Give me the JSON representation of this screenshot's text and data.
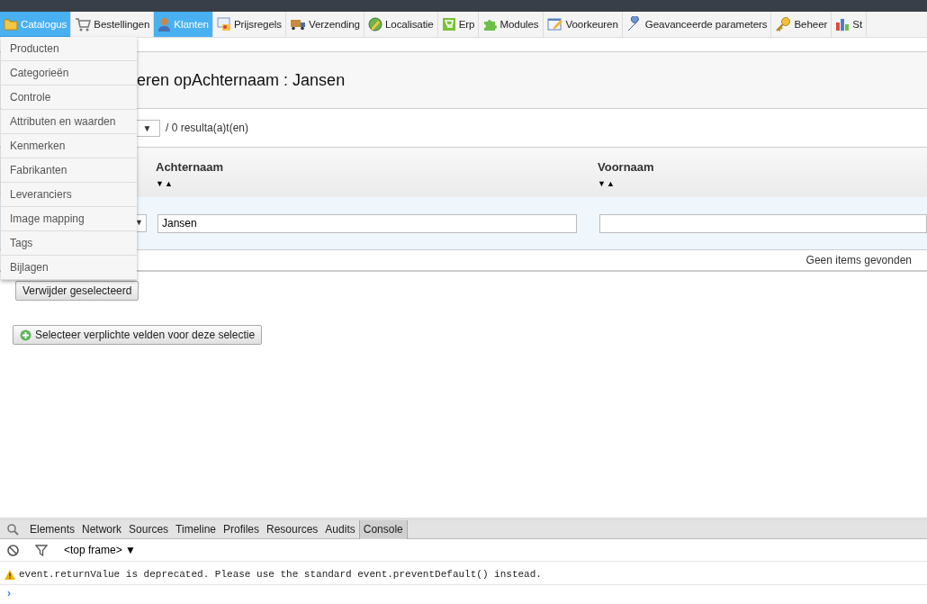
{
  "nav": {
    "tabs": [
      {
        "label": "Catalogus",
        "selected": true,
        "expanded": true
      },
      {
        "label": "Bestellingen",
        "selected": false,
        "expanded": false
      },
      {
        "label": "Klanten",
        "selected": true,
        "expanded": false
      },
      {
        "label": "Prijsregels",
        "selected": false,
        "expanded": false
      },
      {
        "label": "Verzending",
        "selected": false,
        "expanded": false
      },
      {
        "label": "Localisatie",
        "selected": false,
        "expanded": false
      },
      {
        "label": "Erp",
        "selected": false,
        "expanded": false
      },
      {
        "label": "Modules",
        "selected": false,
        "expanded": false
      },
      {
        "label": "Voorkeuren",
        "selected": false,
        "expanded": false
      },
      {
        "label": "Geavanceerde parameters",
        "selected": false,
        "expanded": false
      },
      {
        "label": "Beheer",
        "selected": false,
        "expanded": false
      },
      {
        "label": "St",
        "selected": false,
        "expanded": false
      }
    ],
    "dropdown": [
      "Producten",
      "Categorieën",
      "Controle",
      "Attributen en waarden",
      "Kenmerken",
      "Fabrikanten",
      "Leveranciers",
      "Image mapping",
      "Tags",
      "Bijlagen"
    ]
  },
  "heading": "eren opAchternaam : Jansen",
  "pagination": {
    "select_arrow": "▼",
    "results": "/ 0 resulta(a)t(en)"
  },
  "table": {
    "columns": [
      {
        "label": "Achternaam",
        "filter": "Jansen"
      },
      {
        "label": "Voornaam"
      }
    ],
    "filter_select_arrow": "▼",
    "sort_down": "▼",
    "sort_up": "▲",
    "empty": "Geen items gevonden"
  },
  "buttons": [
    "Verwijder geselecteerd",
    "Selecteer verplichte velden voor deze selectie"
  ],
  "devtools": {
    "tabs": [
      {
        "label": "Elements",
        "selected": false
      },
      {
        "label": "Network",
        "selected": false
      },
      {
        "label": "Sources",
        "selected": false
      },
      {
        "label": "Timeline",
        "selected": false
      },
      {
        "label": "Profiles",
        "selected": false
      },
      {
        "label": "Resources",
        "selected": false
      },
      {
        "label": "Audits",
        "selected": false
      },
      {
        "label": "Console",
        "selected": true
      }
    ],
    "frame": "<top frame>",
    "frame_arrow": "▼",
    "message": "event.returnValue is deprecated. Please use the standard event.preventDefault() instead.",
    "prompt": "›"
  }
}
